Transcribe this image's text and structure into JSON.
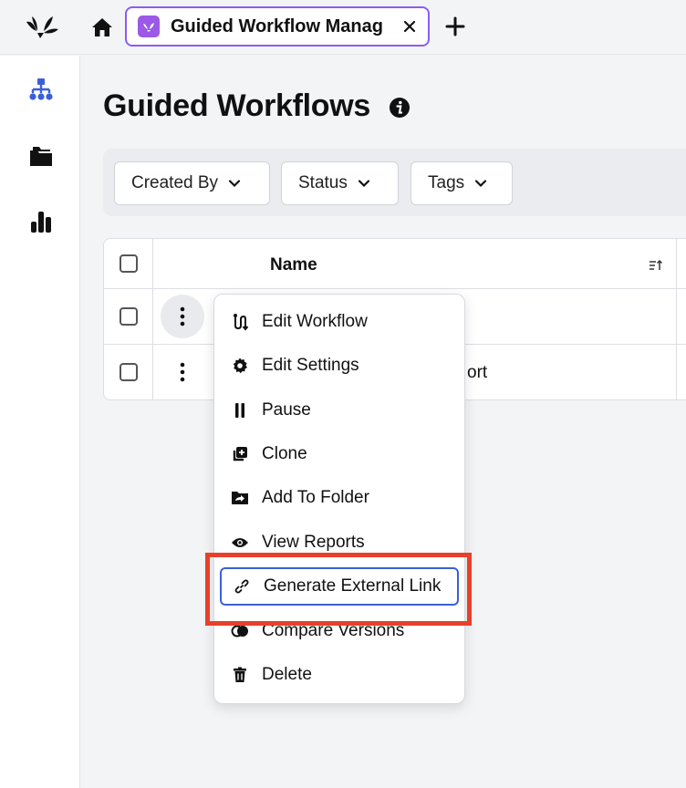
{
  "topbar": {
    "tab_title": "Guided Workflow Manag",
    "icons": [
      "app-logo",
      "home-icon",
      "tab-app-icon",
      "close-icon",
      "plus-icon"
    ]
  },
  "sidebar": {
    "items": [
      {
        "icon": "hierarchy-icon",
        "active": true,
        "color": "#3b5fd9"
      },
      {
        "icon": "folder-icon",
        "active": false
      },
      {
        "icon": "bar-chart-icon",
        "active": false
      }
    ]
  },
  "page": {
    "title": "Guided Workflows"
  },
  "filters": {
    "created_by": "Created By",
    "status": "Status",
    "tags": "Tags"
  },
  "table": {
    "columns": [
      "Name"
    ],
    "rows": [
      {
        "name": ""
      },
      {
        "name": "ort"
      }
    ]
  },
  "context_menu": {
    "items": [
      {
        "label": "Edit Workflow",
        "icon": "workflow-icon"
      },
      {
        "label": "Edit Settings",
        "icon": "gear-icon"
      },
      {
        "label": "Pause",
        "icon": "pause-icon"
      },
      {
        "label": "Clone",
        "icon": "clone-icon"
      },
      {
        "label": "Add To Folder",
        "icon": "folder-move-icon"
      },
      {
        "label": "View Reports",
        "icon": "eye-icon"
      },
      {
        "label": "Generate External Link",
        "icon": "link-icon",
        "focused": true
      },
      {
        "label": "Compare Versions",
        "icon": "compare-icon"
      },
      {
        "label": "Delete",
        "icon": "trash-icon"
      }
    ]
  },
  "colors": {
    "accent": "#3b5fd9",
    "tab_border": "#8b5cf6",
    "highlight": "#e8402a"
  }
}
